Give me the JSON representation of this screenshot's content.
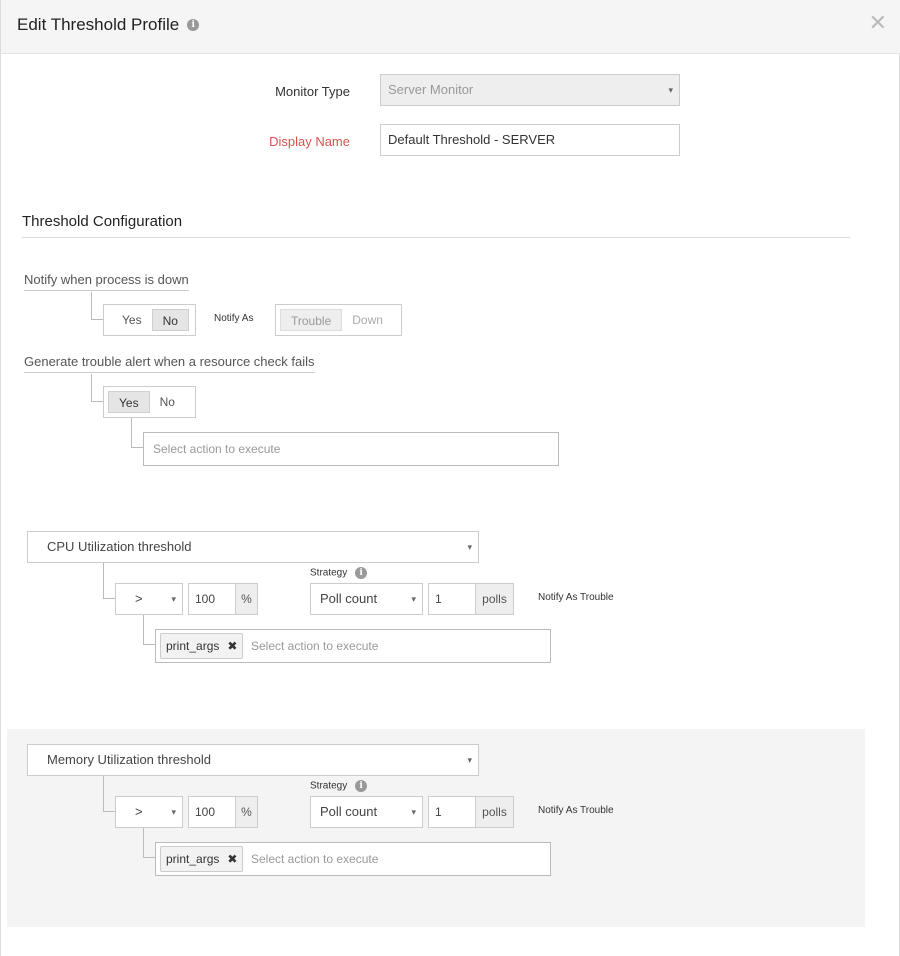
{
  "dialog": {
    "title": "Edit Threshold Profile",
    "close_symbol": "✕"
  },
  "form": {
    "monitor_type_label": "Monitor Type",
    "monitor_type_value": "Server Monitor",
    "display_name_label": "Display Name",
    "display_name_value": "Default Threshold - SERVER",
    "required_label_color": "#d9534f"
  },
  "threshold_config": {
    "title": "Threshold Configuration",
    "notify_process_down": {
      "label": "Notify when process is down",
      "yes": "Yes",
      "no": "No",
      "selected": "No",
      "notify_as_label": "Notify As",
      "trouble": "Trouble",
      "down": "Down",
      "notify_as_selected": "Trouble"
    },
    "resource_check": {
      "label": "Generate trouble alert when a resource check fails",
      "yes": "Yes",
      "no": "No",
      "selected": "Yes",
      "action_placeholder": "Select action to execute"
    }
  },
  "thresholds": [
    {
      "name": "CPU Utilization threshold",
      "operator": ">",
      "value": "100",
      "unit": "%",
      "strategy_label": "Strategy",
      "strategy": "Poll count",
      "polls_value": "1",
      "polls_unit": "polls",
      "notify_as": "Notify As Trouble",
      "action_chip": "print_args",
      "action_placeholder": "Select action to execute"
    },
    {
      "name": "Memory Utilization threshold",
      "operator": ">",
      "value": "100",
      "unit": "%",
      "strategy_label": "Strategy",
      "strategy": "Poll count",
      "polls_value": "1",
      "polls_unit": "polls",
      "notify_as": "Notify As Trouble",
      "action_chip": "print_args",
      "action_placeholder": "Select action to execute"
    }
  ],
  "icons": {
    "info": "i",
    "caret": "▾",
    "remove": "✖"
  }
}
